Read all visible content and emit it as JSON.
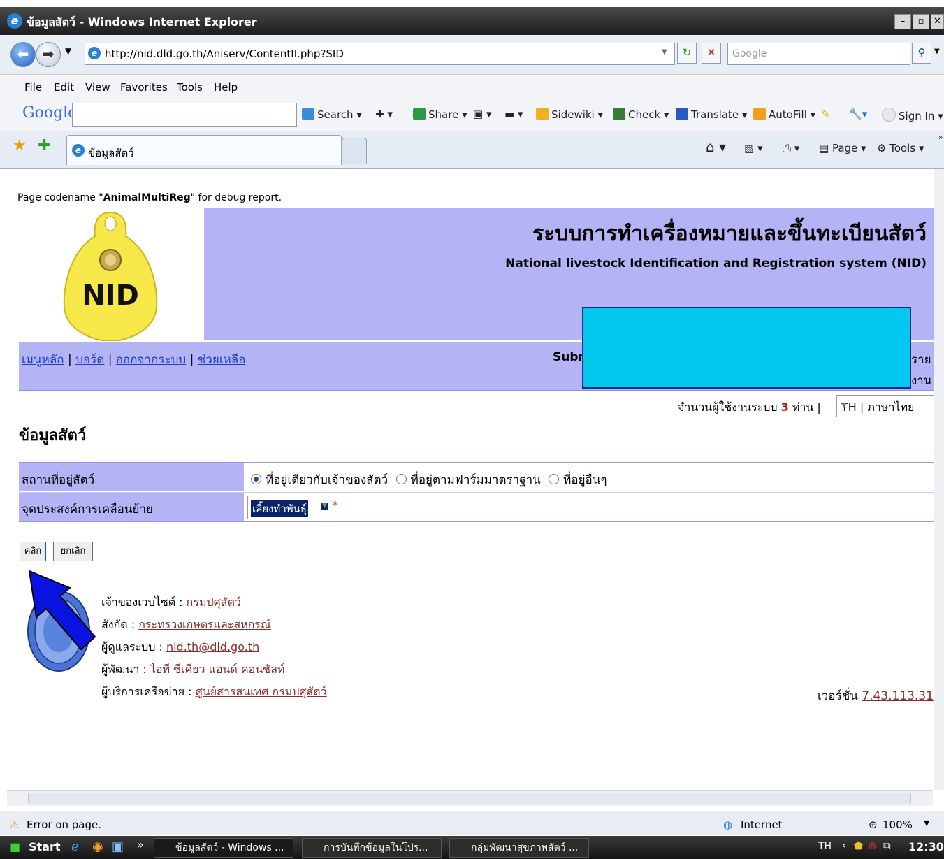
{
  "window": {
    "title": "ข้อมูลสัตว์ - Windows Internet Explorer"
  },
  "address": {
    "url": "http://nid.dld.go.th/Aniserv/ContentII.php?SID",
    "search_placeholder": "Google"
  },
  "menubar": [
    "File",
    "Edit",
    "View",
    "Favorites",
    "Tools",
    "Help"
  ],
  "google_toolbar": {
    "logo": "Google",
    "search": "Search",
    "share": "Share",
    "sidewiki": "Sidewiki",
    "check": "Check",
    "translate": "Translate",
    "autofill": "AutoFill",
    "signin": "Sign In"
  },
  "tab": {
    "label": "ข้อมูลสัตว์"
  },
  "command_bar": {
    "page": "Page",
    "tools": "Tools"
  },
  "page": {
    "codename_prefix": "Page codename \"",
    "codename": "AnimalMultiReg",
    "codename_suffix": "\" for debug report.",
    "logo_text": "NID",
    "thai_title": "ระบบการทำเครื่องหมายและขึ้นทะเบียนสัตว์",
    "en_title": "National livestock Identification and Registration system (NID)",
    "nav": [
      "เมนูหลัก",
      "บอร์ด",
      "ออกจากระบบ",
      "ช่วยเหลือ"
    ],
    "nav_sep": "|",
    "submitter_partial": "Subm",
    "right_partial_1": "ราย",
    "right_partial_2": "งาน",
    "usercount_prefix": "จำนวนผู้ใช้งานระบบ",
    "usercount_value": "3",
    "usercount_suffix": "ท่าน |",
    "lang_select": "TH | ภาษาไทย",
    "heading": "ข้อมูลสัตว์",
    "form": {
      "location_label": "สถานที่อยู่สัตว์",
      "location_options": [
        "ที่อยู่เดียวกับเจ้าของสัตว์",
        "ที่อยู่ตามฟาร์มมาตราฐาน",
        "ที่อยู่อื่นๆ"
      ],
      "purpose_label": "จุดประสงค์การเคลื่อนย้าย",
      "purpose_value": "เลี้ยงทำพันธุ์",
      "required_mark": "*"
    },
    "buttons": {
      "submit": "คลิก",
      "cancel": "ยกเลิก"
    },
    "footer": [
      {
        "label": "เจ้าของเวบไซต์ : ",
        "value": "กรมปศุสัตว์"
      },
      {
        "label": "สังกัด : ",
        "value": "กระทรวงเกษตรและสหกรณ์"
      },
      {
        "label": "ผู้ดูแลระบบ : ",
        "value": "nid.th@dld.go.th"
      },
      {
        "label": "ผู้พัฒนา : ",
        "value": "ไอที ซีเคียว แอนด์ คอนซัลท์"
      },
      {
        "label": "ผู้บริการเครือข่าย : ",
        "value": "ศูนย์สารสนเทศ กรมปศุสัตว์"
      }
    ],
    "version_label": "เวอร์ชั่น",
    "version_value": "7.43.113.31"
  },
  "status": {
    "error": "Error on page.",
    "zone": "Internet",
    "zoom": "100%"
  },
  "taskbar": {
    "start": "Start",
    "items": [
      "ข้อมูลสัตว์ - Windows ...",
      "การบันทึกข้อมูลในโปร...",
      "กลุ่มพัฒนาสุขภาพสัตว์ ..."
    ],
    "lang": "TH",
    "clock": "12:30"
  },
  "colors": {
    "banner": "#b3b3f5",
    "highlight": "#00c8ef",
    "arrow": "#0a14e0"
  }
}
